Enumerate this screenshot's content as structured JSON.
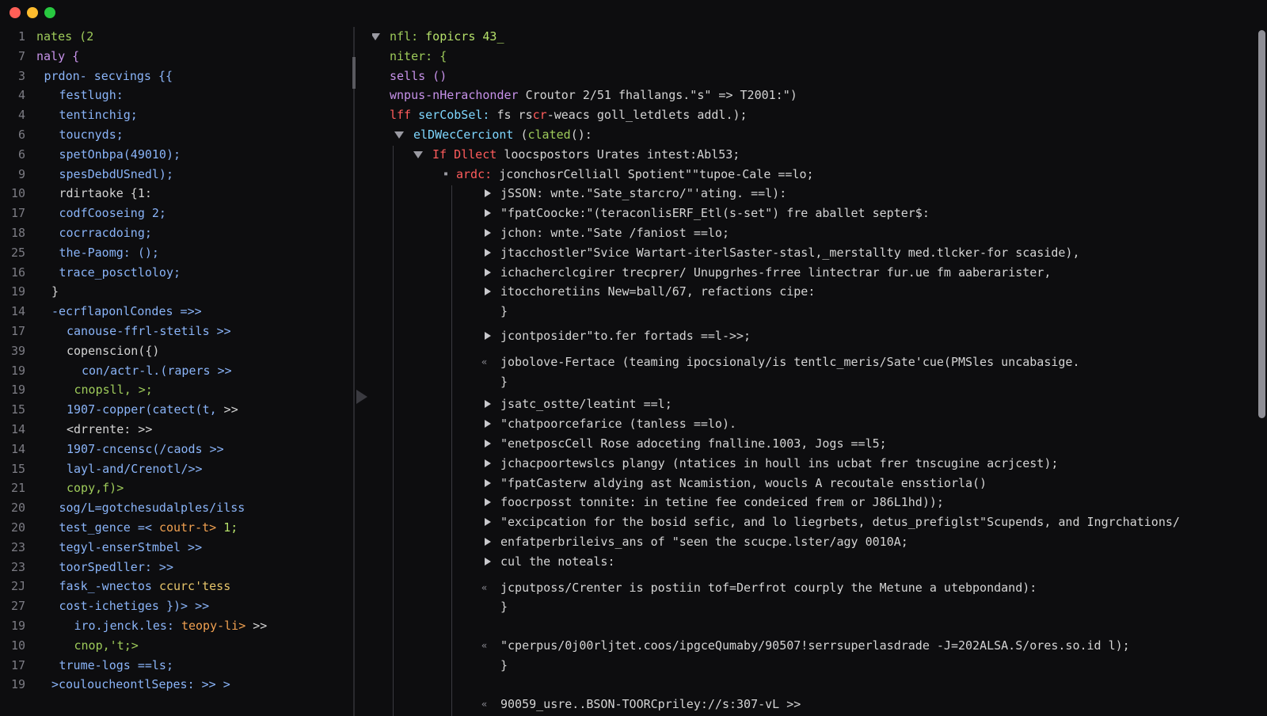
{
  "window": {
    "traffic_lights": [
      {
        "name": "close",
        "color": "#ff5f57"
      },
      {
        "name": "minimize",
        "color": "#febc2e"
      },
      {
        "name": "zoom",
        "color": "#28c840"
      }
    ]
  },
  "colors": {
    "green": "#9ecb5a",
    "blue": "#8ab4f8",
    "purple": "#c792ea",
    "red": "#ff5c5c",
    "orange": "#f0a050",
    "plain": "#d4d4d4",
    "cyan": "#7fd7ff",
    "lime": "#b5e06a",
    "yellow": "#e6c46a"
  },
  "left_pane": {
    "lines": [
      {
        "num": "1",
        "indent": 0,
        "segments": [
          {
            "text": "nates (2",
            "color": "green"
          }
        ]
      },
      {
        "num": "7",
        "indent": 0,
        "segments": [
          {
            "text": "naly {",
            "color": "purple"
          }
        ]
      },
      {
        "num": "3",
        "indent": 1,
        "segments": [
          {
            "text": "prdon- secvings {{",
            "color": "blue"
          }
        ]
      },
      {
        "num": "4",
        "indent": 3,
        "segments": [
          {
            "text": "festlugh:",
            "color": "blue"
          }
        ]
      },
      {
        "num": "4",
        "indent": 3,
        "segments": [
          {
            "text": "tentinchig;",
            "color": "blue"
          }
        ]
      },
      {
        "num": "6",
        "indent": 3,
        "segments": [
          {
            "text": "toucnyds;",
            "color": "blue"
          }
        ]
      },
      {
        "num": "6",
        "indent": 3,
        "segments": [
          {
            "text": "spetOnbpa(49010);",
            "color": "blue"
          }
        ]
      },
      {
        "num": "9",
        "indent": 3,
        "segments": [
          {
            "text": "spesDebdUSnedl);",
            "color": "blue"
          }
        ]
      },
      {
        "num": "10",
        "indent": 3,
        "segments": [
          {
            "text": "rdirtaoke {1:",
            "color": "plain"
          }
        ]
      },
      {
        "num": "17",
        "indent": 3,
        "segments": [
          {
            "text": "codfCooseing 2;",
            "color": "blue"
          }
        ]
      },
      {
        "num": "18",
        "indent": 3,
        "segments": [
          {
            "text": "cocrracdoing;",
            "color": "blue"
          }
        ]
      },
      {
        "num": "25",
        "indent": 3,
        "segments": [
          {
            "text": "the-Paomg: ();",
            "color": "blue"
          }
        ]
      },
      {
        "num": "16",
        "indent": 3,
        "segments": [
          {
            "text": "trace_posctloloy;",
            "color": "blue"
          }
        ]
      },
      {
        "num": "19",
        "indent": 2,
        "segments": [
          {
            "text": "}",
            "color": "plain"
          }
        ]
      },
      {
        "num": "14",
        "indent": 2,
        "segments": [
          {
            "text": "-ecrflaponlCondes =>>",
            "color": "blue"
          }
        ]
      },
      {
        "num": "17",
        "indent": 4,
        "segments": [
          {
            "text": "canouse-ffrl-stetils >>",
            "color": "blue"
          }
        ]
      },
      {
        "num": "39",
        "indent": 4,
        "segments": [
          {
            "text": "copenscion({)",
            "color": "plain"
          }
        ]
      },
      {
        "num": "19",
        "indent": 6,
        "segments": [
          {
            "text": "con/actr-l.(rapers >>",
            "color": "blue"
          }
        ]
      },
      {
        "num": "19",
        "indent": 5,
        "segments": [
          {
            "text": "cnopsll, >;",
            "color": "green"
          }
        ]
      },
      {
        "num": "15",
        "indent": 4,
        "segments": [
          {
            "text": "1907-copper(catect(t,",
            "color": "blue"
          },
          {
            "text": " >>",
            "color": "plain"
          }
        ]
      },
      {
        "num": "14",
        "indent": 4,
        "segments": [
          {
            "text": "<drrente: >>",
            "color": "plain"
          }
        ]
      },
      {
        "num": "14",
        "indent": 4,
        "segments": [
          {
            "text": "1907-cncensc(/caods >>",
            "color": "blue"
          }
        ]
      },
      {
        "num": "15",
        "indent": 4,
        "segments": [
          {
            "text": "layl-and/Crenotl/>>",
            "color": "blue"
          }
        ]
      },
      {
        "num": "21",
        "indent": 4,
        "segments": [
          {
            "text": "copy,f)>",
            "color": "green"
          }
        ]
      },
      {
        "num": "20",
        "indent": 3,
        "segments": [
          {
            "text": "sog/L=gotchesudalples/ilss",
            "color": "blue"
          }
        ]
      },
      {
        "num": "20",
        "indent": 3,
        "segments": [
          {
            "text": "test_gence =< ",
            "color": "blue"
          },
          {
            "text": "coutr-t>",
            "color": "orange"
          },
          {
            "text": " 1;",
            "color": "lime"
          }
        ]
      },
      {
        "num": "23",
        "indent": 3,
        "segments": [
          {
            "text": "tegyl-enserStmbel >>",
            "color": "blue"
          }
        ]
      },
      {
        "num": "23",
        "indent": 3,
        "segments": [
          {
            "text": "toorSpedller: >>",
            "color": "blue"
          }
        ]
      },
      {
        "num": "2J",
        "indent": 3,
        "segments": [
          {
            "text": "fask_-wnectos ",
            "color": "blue"
          },
          {
            "text": "ccurc'tess",
            "color": "yellow"
          }
        ]
      },
      {
        "num": "27",
        "indent": 3,
        "segments": [
          {
            "text": "cost-ichetiges })> >>",
            "color": "blue"
          }
        ]
      },
      {
        "num": "19",
        "indent": 5,
        "segments": [
          {
            "text": "iro.jenck.les: ",
            "color": "blue"
          },
          {
            "text": "teopy-li>",
            "color": "orange"
          },
          {
            "text": " >>",
            "color": "plain"
          }
        ]
      },
      {
        "num": "10",
        "indent": 5,
        "segments": [
          {
            "text": "cnop,'t;>",
            "color": "green"
          }
        ]
      },
      {
        "num": "17",
        "indent": 3,
        "segments": [
          {
            "text": "trume-logs ==ls;",
            "color": "blue"
          }
        ]
      },
      {
        "num": "19",
        "indent": 2,
        "segments": [
          {
            "text": ">couloucheontlSepes: >> >",
            "color": "blue"
          }
        ]
      }
    ]
  },
  "right_pane": {
    "lines": [
      {
        "marker": "down",
        "indent": 0,
        "segments": [
          {
            "text": "nfl: ",
            "color": "green"
          },
          {
            "text": "fopicrs 43_",
            "color": "lime"
          }
        ]
      },
      {
        "marker": "none",
        "indent": 0,
        "segments": [
          {
            "text": "niter: {",
            "color": "green"
          }
        ]
      },
      {
        "marker": "none",
        "indent": 0,
        "segments": [
          {
            "text": "sells ()",
            "color": "purple"
          }
        ]
      },
      {
        "marker": "none",
        "indent": 0,
        "segments": [
          {
            "text": "wnpus-nHerachonder",
            "color": "purple"
          },
          {
            "text": " Croutor 2/51 fhallangs.\"s\" => T2001:\")",
            "color": "plain"
          }
        ]
      },
      {
        "marker": "none",
        "indent": 0,
        "segments": [
          {
            "text": "lff ",
            "color": "red"
          },
          {
            "text": "serCobSel:",
            "color": "cyan"
          },
          {
            "text": " fs rs",
            "color": "plain"
          },
          {
            "text": "cr",
            "color": "red"
          },
          {
            "text": "-weacs goll_letdlets addl.);",
            "color": "plain"
          }
        ]
      },
      {
        "marker": "down",
        "indent": 1,
        "segments": [
          {
            "text": "elDWecCerciont",
            "color": "cyan"
          },
          {
            "text": " (",
            "color": "plain"
          },
          {
            "text": "clated",
            "color": "green"
          },
          {
            "text": "():",
            "color": "plain"
          }
        ]
      },
      {
        "marker": "down",
        "indent": 2,
        "segments": [
          {
            "text": "If Dllect ",
            "color": "red"
          },
          {
            "text": "loocspostors Urates intest:Abl53;",
            "color": "plain"
          }
        ]
      },
      {
        "marker": "dot",
        "indent": 3,
        "segments": [
          {
            "text": "ardc: ",
            "color": "red"
          },
          {
            "text": "jconchosrCelliall Spotient\"\"tupoe-Cale ==lo;",
            "color": "plain"
          }
        ]
      },
      {
        "marker": "right",
        "indent": 4,
        "segments": [
          {
            "text": "jSSON: wnte.\"Sate_starcro/\"'ating. ==l):",
            "color": "plain"
          }
        ]
      },
      {
        "marker": "right",
        "indent": 4,
        "segments": [
          {
            "text": "\"fpatCoocke:\"(teraconlisERF_Etl(s-set\") fre aballet septer$:",
            "color": "plain"
          }
        ]
      },
      {
        "marker": "right",
        "indent": 4,
        "segments": [
          {
            "text": "jchon: wnte.\"Sate /faniost ==lo;",
            "color": "plain"
          }
        ]
      },
      {
        "marker": "right",
        "indent": 4,
        "segments": [
          {
            "text": "jtacchostler\"Svice Wartart-iterlSaster-stasl,_merstallty med.tlcker-for scaside),",
            "color": "plain"
          }
        ]
      },
      {
        "marker": "right",
        "indent": 4,
        "segments": [
          {
            "text": "ichacherclcgirer trecprer/ Unupgrhes-frree lintectrar fur.ue fm aaberarister,",
            "color": "plain"
          }
        ]
      },
      {
        "marker": "right",
        "indent": 4,
        "segments": [
          {
            "text": "itocchoretiins New=ball/67, refactions cipe:",
            "color": "plain"
          }
        ]
      },
      {
        "marker": "none",
        "indent": 4,
        "segments": [
          {
            "text": "}",
            "color": "plain"
          }
        ]
      },
      {
        "marker": "right",
        "indent": 4,
        "segments": [
          {
            "text": "jcontposider\"to.fer fortads ==l->>;",
            "color": "plain"
          }
        ]
      },
      {
        "marker": "comment",
        "indent": 4,
        "segments": [
          {
            "text": "jobolove-Fertace (teaming ipocsionaly/is tentlc_meris/Sate'cue(PMSles uncabasige.",
            "color": "plain"
          }
        ]
      },
      {
        "marker": "none",
        "indent": 4,
        "segments": [
          {
            "text": "}",
            "color": "plain"
          }
        ]
      },
      {
        "marker": "right",
        "indent": 4,
        "segments": [
          {
            "text": "jsatc_ostte/leatint ==l;",
            "color": "plain"
          }
        ]
      },
      {
        "marker": "right",
        "indent": 4,
        "segments": [
          {
            "text": "\"chatpoorcefarice (tanless ==lo).",
            "color": "plain"
          }
        ]
      },
      {
        "marker": "right",
        "indent": 4,
        "segments": [
          {
            "text": "\"enetposcCell Rose adoceting fnalline.1003, Jogs ==l5;",
            "color": "plain"
          }
        ]
      },
      {
        "marker": "right",
        "indent": 4,
        "segments": [
          {
            "text": "jchacpoortewslcs plangy (ntatices in houll ins ucbat frer tnscugine acrjcest);",
            "color": "plain"
          }
        ]
      },
      {
        "marker": "right",
        "indent": 4,
        "segments": [
          {
            "text": "\"fpatCasterw aldying ast Ncamistion, woucls A recoutale ensstiorla()",
            "color": "plain"
          }
        ]
      },
      {
        "marker": "right",
        "indent": 4,
        "segments": [
          {
            "text": "foocrposst tonnite: in tetine fee condeiced frem or J86L1hd));",
            "color": "plain"
          }
        ]
      },
      {
        "marker": "right",
        "indent": 4,
        "segments": [
          {
            "text": "\"excipcation for the bosid sefic, and lo liegrbets, detus_prefiglst\"Scupends, and Ingrchations/",
            "color": "plain"
          }
        ]
      },
      {
        "marker": "right",
        "indent": 4,
        "segments": [
          {
            "text": "enfatperbrileivs_ans of \"seen the scucpe.lster/agy 0010A;",
            "color": "plain"
          }
        ]
      },
      {
        "marker": "right",
        "indent": 4,
        "segments": [
          {
            "text": "cul the noteals:",
            "color": "plain"
          }
        ]
      },
      {
        "marker": "comment",
        "indent": 4,
        "segments": [
          {
            "text": "jcputposs/Crenter is postiin tof=Derfrot courply the Metune a utebpondand):",
            "color": "plain"
          }
        ]
      },
      {
        "marker": "none",
        "indent": 4,
        "segments": [
          {
            "text": "}",
            "color": "plain"
          }
        ]
      },
      {
        "marker": "comment",
        "indent": 4,
        "segments": [
          {
            "text": "\"cperpus/0j00rljtet.coos/ipgceQumaby/90507!serrsuperlasdrade -J=202ALSA.S/ores.so.id l);",
            "color": "plain"
          }
        ]
      },
      {
        "marker": "none",
        "indent": 4,
        "segments": [
          {
            "text": "}",
            "color": "plain"
          }
        ]
      },
      {
        "marker": "comment",
        "indent": 4,
        "segments": [
          {
            "text": "90059_usre..BSON-TOORCpriley://s:307-vL >>",
            "color": "plain"
          }
        ]
      }
    ]
  }
}
